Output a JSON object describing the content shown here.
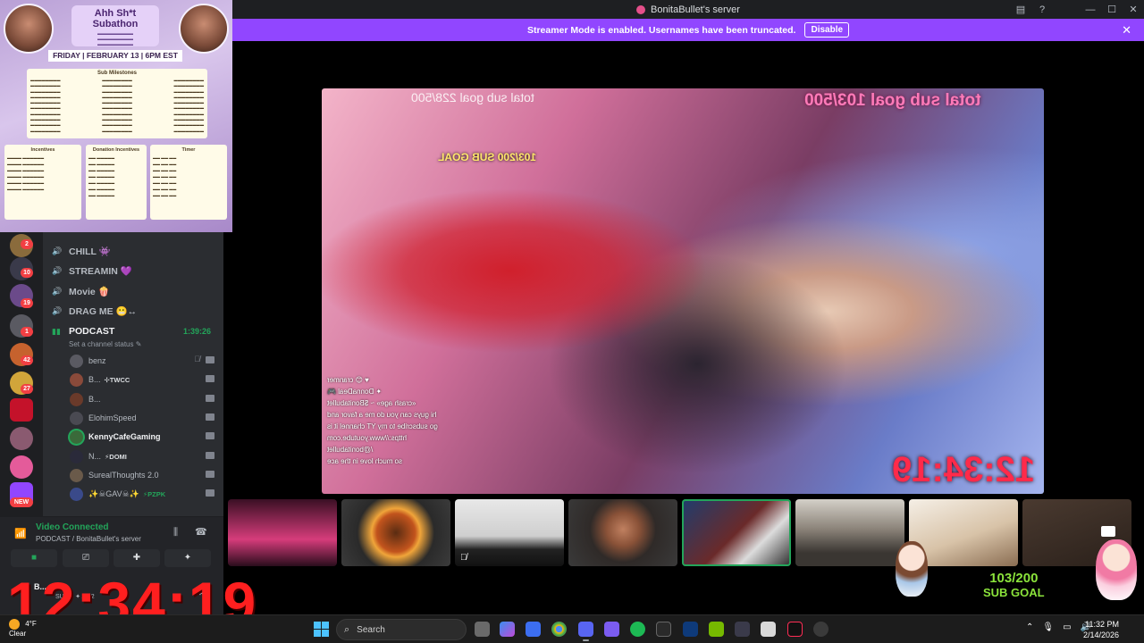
{
  "window": {
    "title": "BonitaBullet's server"
  },
  "streamer_mode": {
    "message": "Streamer Mode is enabled. Usernames have been truncated.",
    "disable_label": "Disable",
    "close_glyph": "✕"
  },
  "poster": {
    "headline": "Ahh Sh*t Subathon",
    "date_line": "FRIDAY | FEBRUARY 13 | 6PM EST",
    "milestones_title": "Sub Milestones",
    "incentives_title": "Incentives",
    "donation_title": "Donation Incentives",
    "timer_title": "Timer"
  },
  "rail_badges": [
    "2",
    "10",
    "19",
    "1",
    "42",
    "27"
  ],
  "rail_new": "NEW",
  "voice_channels": [
    {
      "name": "CHILL 👾"
    },
    {
      "name": "STREAMIN 💜"
    },
    {
      "name": "Movie 🍿"
    },
    {
      "name": "DRAG ME 😬↔"
    },
    {
      "name": "PODCAST"
    }
  ],
  "podcast": {
    "status_placeholder": "Set a channel status ✎",
    "elapsed": "1:39:26"
  },
  "members": [
    {
      "name": "benz",
      "tag": ""
    },
    {
      "name": "B...",
      "tag": "✢TWCC"
    },
    {
      "name": "B...",
      "tag": ""
    },
    {
      "name": "ElohimSpeed",
      "tag": ""
    },
    {
      "name": "KennyCafeGaming",
      "tag": ""
    },
    {
      "name": "N...",
      "tag": "⚡DOMI"
    },
    {
      "name": "SurealThoughts 2.0",
      "tag": ""
    },
    {
      "name": "✨☠GAV☠✨",
      "tag": "⚡PZPK"
    }
  ],
  "voice_panel": {
    "status": "Video Connected",
    "location": "PODCAST / BonitaBullet's server"
  },
  "user_panel": {
    "name": "B...",
    "status": "SUB... ✦ A 42"
  },
  "overlay_timer": "12:34:19",
  "stream_overlay": {
    "total_goal": "total sub goal",
    "total_value": "228/500",
    "sub_goal_small": "103/200 SUB GOAL",
    "total_goal_right": "total sub goal 103/500",
    "chat_lines": [
      "♥ 😊 cranmer",
      "✦ DonnaDeal 🎮",
      "«crash age» ~ $Bonitabullet",
      "hi guys can you do me a favor and",
      "go subscribe to my YT channel it is",
      "https://www.youtube.com",
      "/@bonitabullet",
      "so much love in the ace"
    ],
    "timer": "12:34:19"
  },
  "sub_goal": {
    "count": "103/200",
    "label": "SUB GOAL"
  },
  "taskbar": {
    "weather_temp": "4°F",
    "weather_desc": "Clear",
    "search_placeholder": "Search",
    "time": "11:32 PM",
    "date": "2/14/2026"
  }
}
